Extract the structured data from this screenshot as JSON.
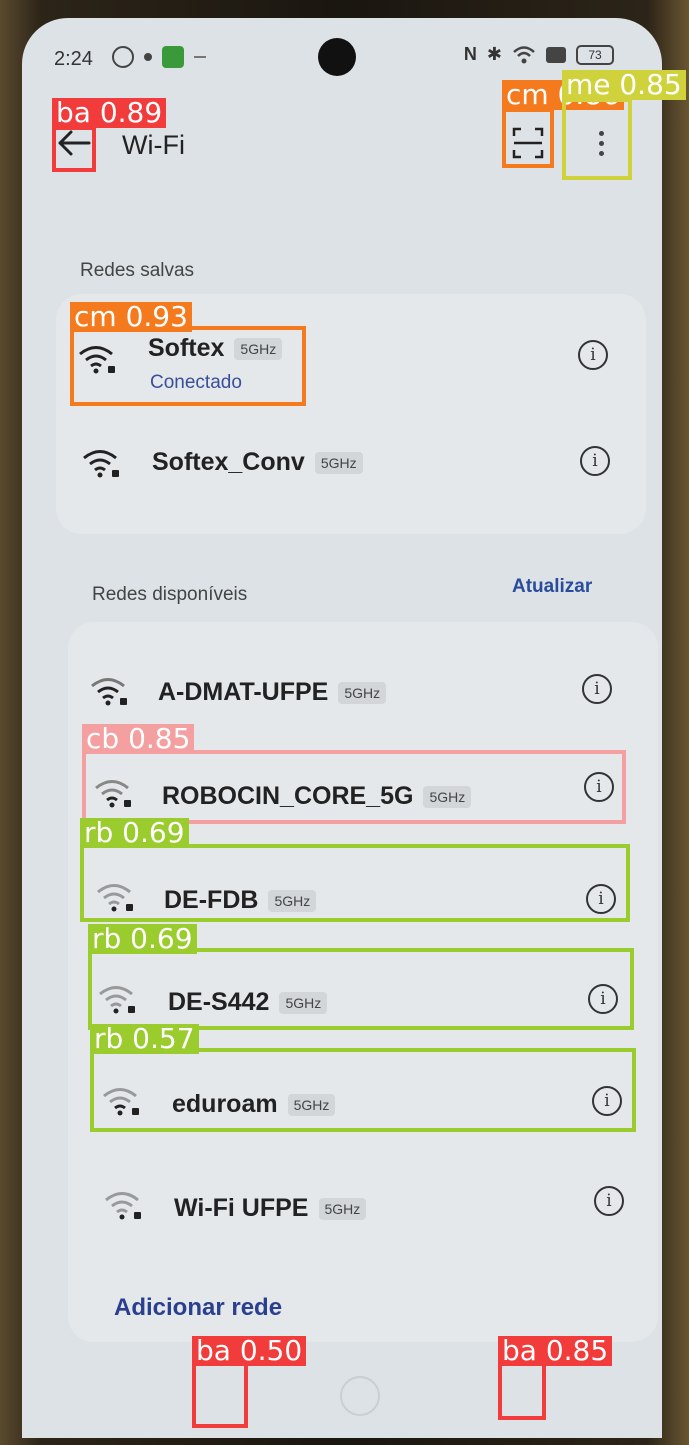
{
  "status_bar": {
    "time": "2:24",
    "battery": "73"
  },
  "toolbar": {
    "title": "Wi-Fi",
    "back_icon": "arrow-left-icon",
    "scan_icon": "qr-scan-icon",
    "more_icon": "more-vert-icon"
  },
  "saved": {
    "label": "Redes salvas",
    "networks": [
      {
        "name": "Softex",
        "band": "5GHz",
        "status": "Conectado"
      },
      {
        "name": "Softex_Conv",
        "band": "5GHz",
        "status": ""
      }
    ]
  },
  "available": {
    "label": "Redes disponíveis",
    "refresh": "Atualizar",
    "networks": [
      {
        "name": "A-DMAT-UFPE",
        "band": "5GHz"
      },
      {
        "name": "ROBOCIN_CORE_5G",
        "band": "5GHz"
      },
      {
        "name": "DE-FDB",
        "band": "5GHz"
      },
      {
        "name": "DE-S442",
        "band": "5GHz"
      },
      {
        "name": "eduroam",
        "band": "5GHz"
      },
      {
        "name": "Wi-Fi UFPE",
        "band": "5GHz"
      }
    ],
    "add_network": "Adicionar rede"
  },
  "detections": [
    {
      "label": "ba 0.89",
      "color": "#f23c3c"
    },
    {
      "label": "cm 0.86",
      "color": "#f57a1e"
    },
    {
      "label": "me 0.85",
      "color": "#cfd23a"
    },
    {
      "label": "cm 0.93",
      "color": "#f57a1e"
    },
    {
      "label": "cb 0.85",
      "color": "#f5a0a0"
    },
    {
      "label": "rb 0.69",
      "color": "#9acc2e"
    },
    {
      "label": "rb 0.69",
      "color": "#9acc2e"
    },
    {
      "label": "rb 0.57",
      "color": "#9acc2e"
    },
    {
      "label": "ba 0.50",
      "color": "#f23c3c"
    },
    {
      "label": "ba 0.85",
      "color": "#f23c3c"
    }
  ]
}
